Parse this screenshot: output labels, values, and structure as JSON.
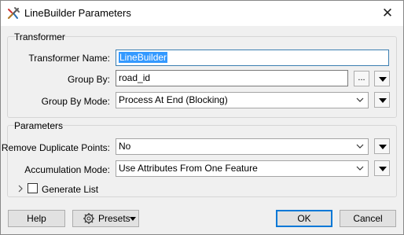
{
  "window": {
    "title": "LineBuilder Parameters",
    "app_icon": "fme-transformer-icon",
    "close_icon": "close-icon"
  },
  "transformer": {
    "section_title": "Transformer",
    "name_label": "Transformer Name:",
    "name_value": "LineBuilder",
    "group_by_label": "Group By:",
    "group_by_value": "road_id",
    "browse_label": "...",
    "group_by_mode_label": "Group By Mode:",
    "group_by_mode_value": "Process At End (Blocking)"
  },
  "parameters": {
    "section_title": "Parameters",
    "remove_dup_label": "Remove Duplicate Points:",
    "remove_dup_value": "No",
    "accumulation_label": "Accumulation Mode:",
    "accumulation_value": "Use Attributes From One Feature",
    "generate_list_label": "Generate List",
    "generate_list_checked": false
  },
  "footer": {
    "help_label": "Help",
    "presets_label": "Presets",
    "ok_label": "OK",
    "cancel_label": "Cancel"
  },
  "colors": {
    "selection": "#3399ff",
    "default_button_border": "#0078d7",
    "focus_border": "#3c7fb1"
  }
}
